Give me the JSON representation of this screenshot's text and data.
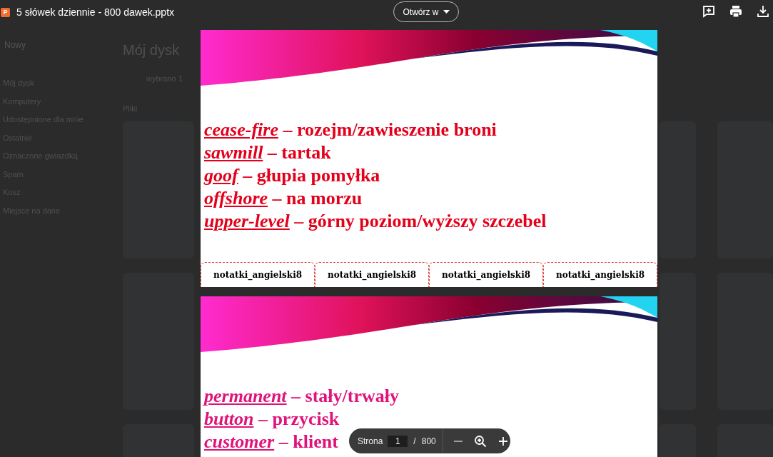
{
  "header": {
    "file_badge": "P",
    "title": "5 słówek dziennie - 800 dawek.pptx",
    "open_button": "Otwórz w"
  },
  "drive_background": {
    "new_button": "Nowy",
    "nav": [
      "Mój dysk",
      "Komputery",
      "Udostępnione dla mnie",
      "Ostatnie",
      "Oznaczone gwiazdką",
      "Spam",
      "Kosz",
      "Miejsce na dane"
    ],
    "heading": "Mój dysk",
    "selection": "wybrano 1",
    "section": "Pliki"
  },
  "slides": [
    {
      "color": "#e3001b",
      "entries": [
        {
          "term": "cease-fire",
          "translation": "– rozejm/zawieszenie broni"
        },
        {
          "term": "sawmill",
          "translation": "– tartak"
        },
        {
          "term": "goof",
          "translation": "– głupia pomyłka"
        },
        {
          "term": "offshore",
          "translation": "– na morzu"
        },
        {
          "term": "upper-level",
          "translation": "– górny poziom/wyższy szczebel"
        }
      ],
      "footer": [
        "notatki_angielski8",
        "notatki_angielski8",
        "notatki_angielski8",
        "notatki_angielski8"
      ]
    },
    {
      "color": "#e0137a",
      "entries": [
        {
          "term": "permanent",
          "translation": "– stały/trwały"
        },
        {
          "term": "button",
          "translation": "– przycisk"
        },
        {
          "term": "customer",
          "translation": "– klient"
        }
      ]
    }
  ],
  "pager": {
    "label": "Strona",
    "page": "1",
    "separator": "/",
    "total": "800"
  }
}
